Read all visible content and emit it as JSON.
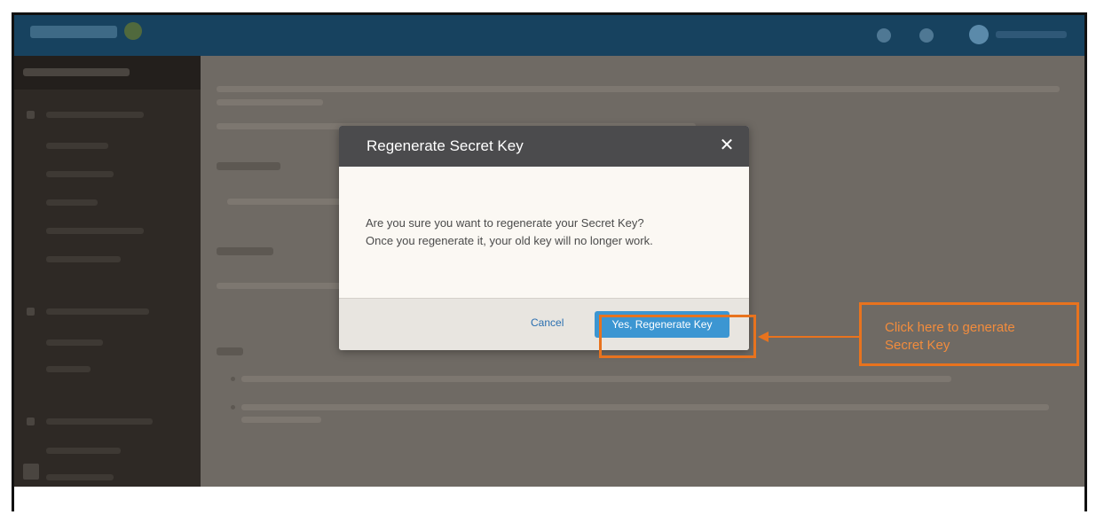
{
  "modal": {
    "title": "Regenerate Secret Key",
    "close_icon": "close-icon",
    "message_line1": "Are you sure you want to regenerate your Secret Key?",
    "message_line2": "Once you regenerate it, your old key will no longer work.",
    "cancel_label": "Cancel",
    "confirm_label": "Yes, Regenerate Key"
  },
  "annotation": {
    "callout_line1": "Click here to generate",
    "callout_line2": "Secret Key",
    "color": "#e8731e"
  },
  "colors": {
    "topbar": "#17425f",
    "primary_button": "#3c96d2",
    "modal_header": "#4b4b4d"
  }
}
